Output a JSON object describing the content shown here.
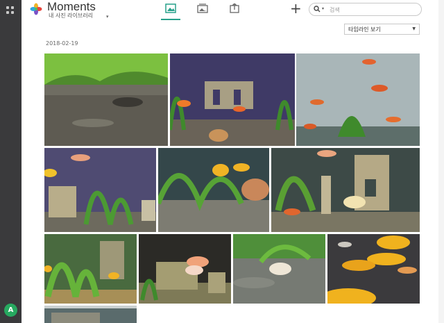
{
  "app": {
    "title": "Moments",
    "library": "내 사진 라이브러리"
  },
  "tabs": [
    {
      "id": "photos",
      "icon": "image-icon",
      "active": true
    },
    {
      "id": "albums",
      "icon": "album-icon",
      "active": false
    },
    {
      "id": "shared",
      "icon": "shared-box-icon",
      "active": false
    }
  ],
  "search": {
    "placeholder": "검색"
  },
  "view_select": {
    "selected": "타임라인 보기"
  },
  "timeline": {
    "date": "2018-02-19"
  },
  "user": {
    "avatar_letter": "A"
  },
  "colors": {
    "rail": "#3a3a3c",
    "accent": "#27a08a",
    "avatar": "#27a960"
  }
}
